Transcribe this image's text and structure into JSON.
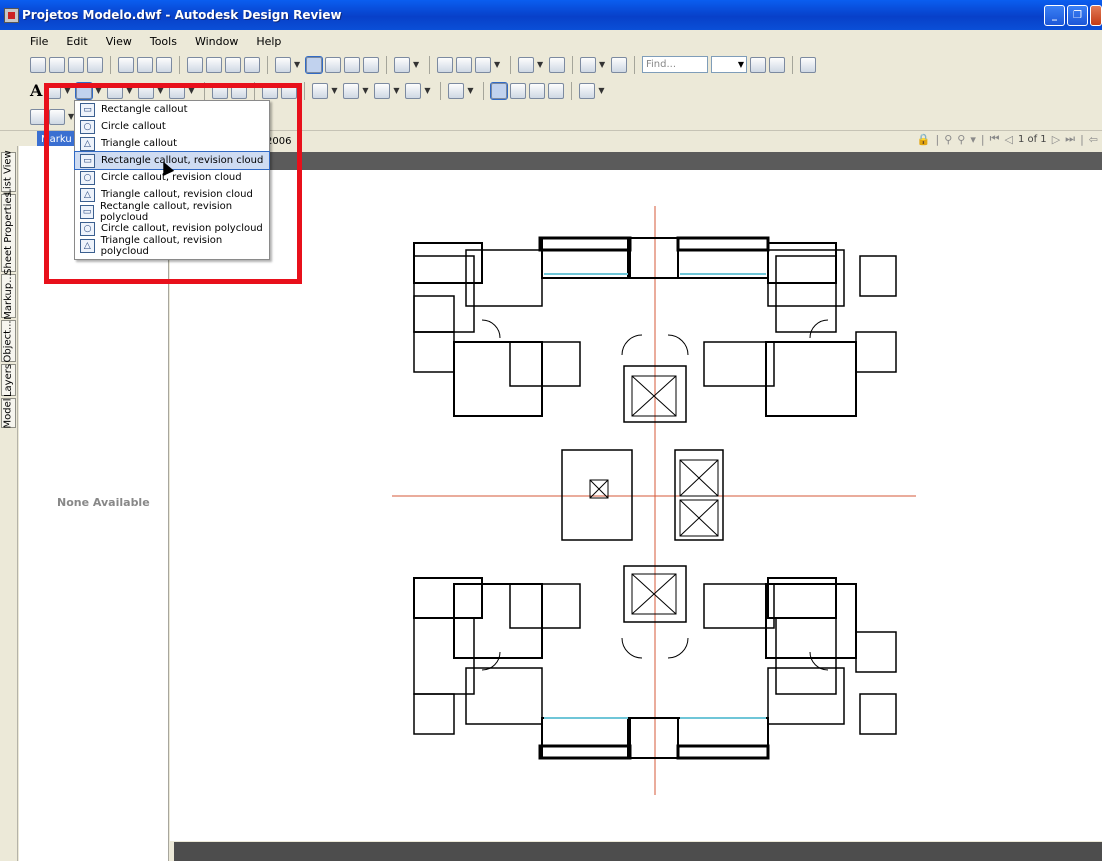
{
  "window": {
    "title": "Projetos Modelo.dwf - Autodesk Design Review",
    "buttons": [
      "_",
      "❐",
      "✕"
    ]
  },
  "menubar": [
    "File",
    "Edit",
    "View",
    "Tools",
    "Window",
    "Help"
  ],
  "toolbar": {
    "find_placeholder": "Find...",
    "text_tool": "A"
  },
  "tabs": {
    "markup_tab": "Marku",
    "date_fragment": "2006"
  },
  "navigation": {
    "page_indicator": "1 of 1"
  },
  "side_tabs": [
    "List View",
    "Sheet Properties",
    "Markup...",
    "Object...",
    "Layers",
    "Model"
  ],
  "left_panel": {
    "message": "None Available"
  },
  "callout_menu": {
    "items": [
      {
        "label": "Rectangle callout",
        "icon": "rectangle-callout-icon"
      },
      {
        "label": "Circle callout",
        "icon": "circle-callout-icon"
      },
      {
        "label": "Triangle callout",
        "icon": "triangle-callout-icon"
      },
      {
        "label": "Rectangle callout, revision cloud",
        "icon": "rectangle-cloud-icon"
      },
      {
        "label": "Circle callout, revision cloud",
        "icon": "circle-cloud-icon"
      },
      {
        "label": "Triangle callout, revision cloud",
        "icon": "triangle-cloud-icon"
      },
      {
        "label": "Rectangle callout, revision polycloud",
        "icon": "rectangle-polycloud-icon"
      },
      {
        "label": "Circle callout, revision polycloud",
        "icon": "circle-polycloud-icon"
      },
      {
        "label": "Triangle callout, revision polycloud",
        "icon": "triangle-polycloud-icon"
      }
    ],
    "highlighted_index": 3
  },
  "colors": {
    "titlebar": "#0a4fd7",
    "highlight_box": "#e8101b",
    "canvas_bar": "#5b5b5b",
    "axis_line": "#d45a3a"
  }
}
